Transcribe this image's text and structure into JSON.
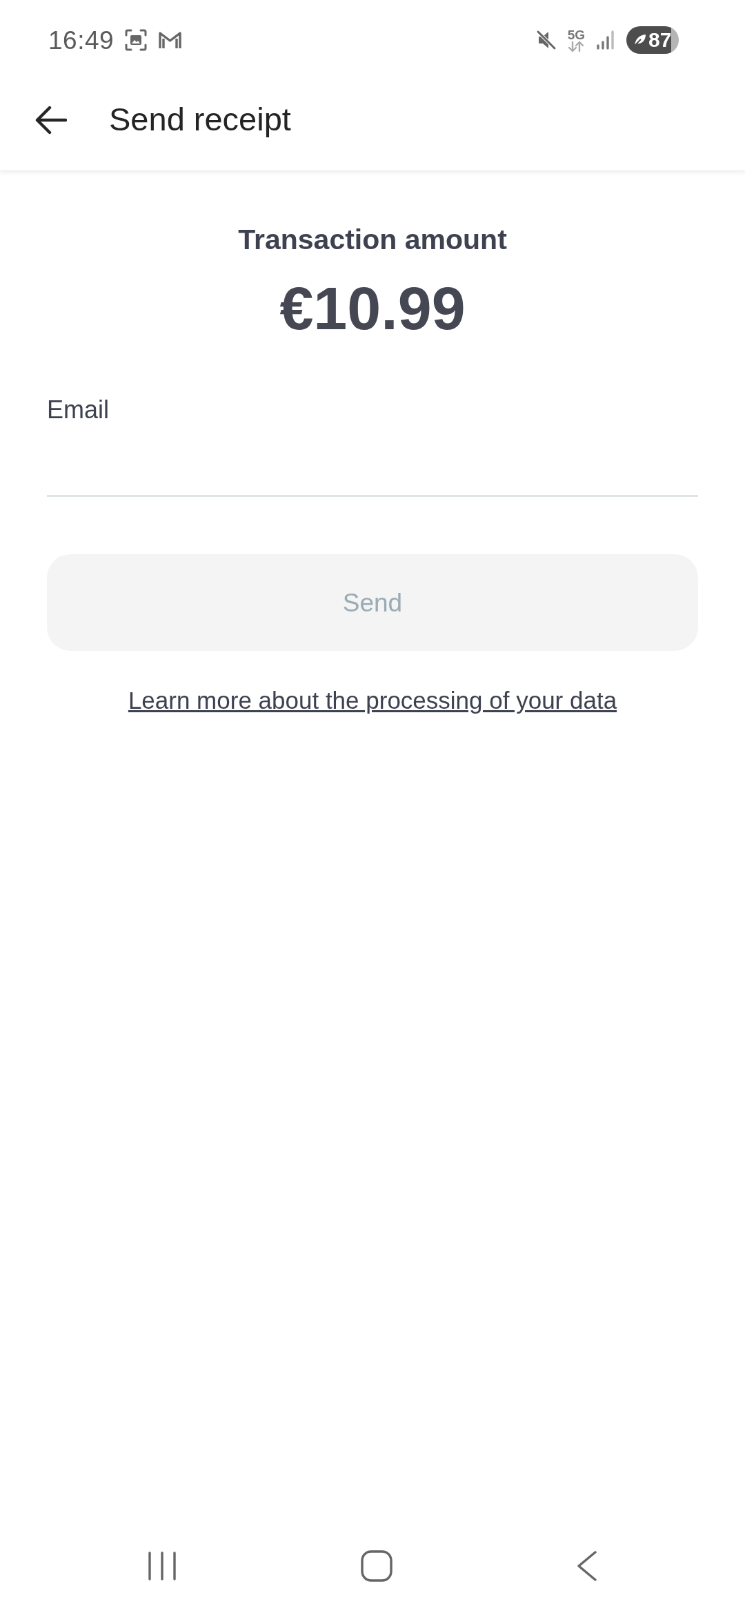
{
  "status_bar": {
    "time": "16:49",
    "network": "5G",
    "battery": "87"
  },
  "header": {
    "title": "Send receipt"
  },
  "amount": {
    "label": "Transaction amount",
    "value": "€10.99"
  },
  "email_field": {
    "label": "Email"
  },
  "send_button": {
    "label": "Send",
    "disabled": true
  },
  "privacy_link": {
    "label": "Learn more about the processing of your data"
  }
}
